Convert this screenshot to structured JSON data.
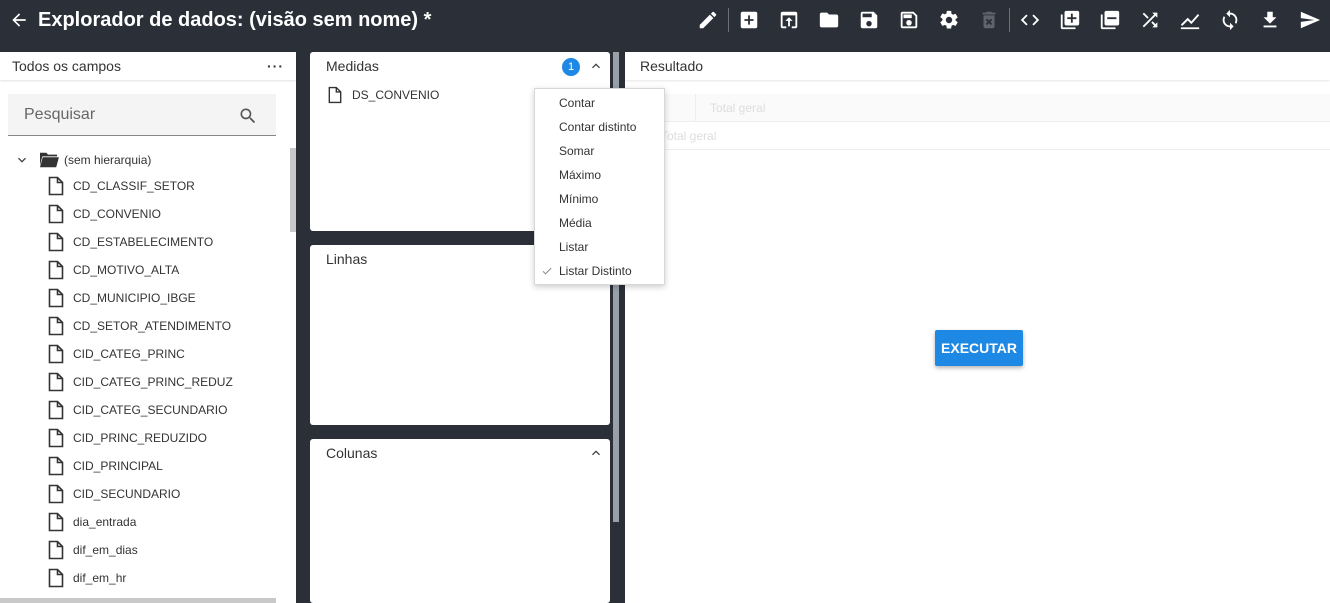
{
  "header": {
    "title": "Explorador de dados: (visão sem nome) *",
    "toolbar": [
      {
        "icon": "pencil-icon",
        "disabled": false
      },
      {
        "icon": "add-box-icon",
        "disabled": false
      },
      {
        "icon": "open-box-icon",
        "disabled": false
      },
      {
        "icon": "folder-icon",
        "disabled": false
      },
      {
        "icon": "save-icon",
        "disabled": false
      },
      {
        "icon": "save-as-icon",
        "disabled": false
      },
      {
        "icon": "gear-icon",
        "disabled": false
      },
      {
        "icon": "delete-icon",
        "disabled": true
      },
      {
        "icon": "code-icon",
        "disabled": false
      },
      {
        "icon": "duplicate-icon",
        "disabled": false
      },
      {
        "icon": "copy-icon",
        "disabled": false
      },
      {
        "icon": "shuffle-icon",
        "disabled": false
      },
      {
        "icon": "chart-icon",
        "disabled": false
      },
      {
        "icon": "refresh-icon",
        "disabled": false
      },
      {
        "icon": "download-icon",
        "disabled": false
      },
      {
        "icon": "send-icon",
        "disabled": false
      }
    ]
  },
  "fields_panel": {
    "title": "Todos os campos",
    "more_label": "···",
    "search_placeholder": "Pesquisar",
    "root_label": "(sem hierarquia)",
    "fields": [
      "CD_CLASSIF_SETOR",
      "CD_CONVENIO",
      "CD_ESTABELECIMENTO",
      "CD_MOTIVO_ALTA",
      "CD_MUNICIPIO_IBGE",
      "CD_SETOR_ATENDIMENTO",
      "CID_CATEG_PRINC",
      "CID_CATEG_PRINC_REDUZ",
      "CID_CATEG_SECUNDARIO",
      "CID_PRINC_REDUZIDO",
      "CID_PRINCIPAL",
      "CID_SECUNDARIO",
      "dia_entrada",
      "dif_em_dias",
      "dif_em_hr"
    ]
  },
  "measures": {
    "title": "Medidas",
    "badge": "1",
    "item": "DS_CONVENIO"
  },
  "rows": {
    "title": "Linhas"
  },
  "columns": {
    "title": "Colunas"
  },
  "result": {
    "title": "Resultado",
    "ghost_header": "Total geral",
    "ghost_row": "Total geral",
    "execute_label": "EXECUTAR"
  },
  "aggregation_menu": {
    "items": [
      "Contar",
      "Contar distinto",
      "Somar",
      "Máximo",
      "Mínimo",
      "Média",
      "Listar",
      "Listar Distinto"
    ],
    "selected": "Listar Distinto"
  },
  "colors": {
    "topbar": "#2b3038",
    "accent": "#1e88e5"
  }
}
